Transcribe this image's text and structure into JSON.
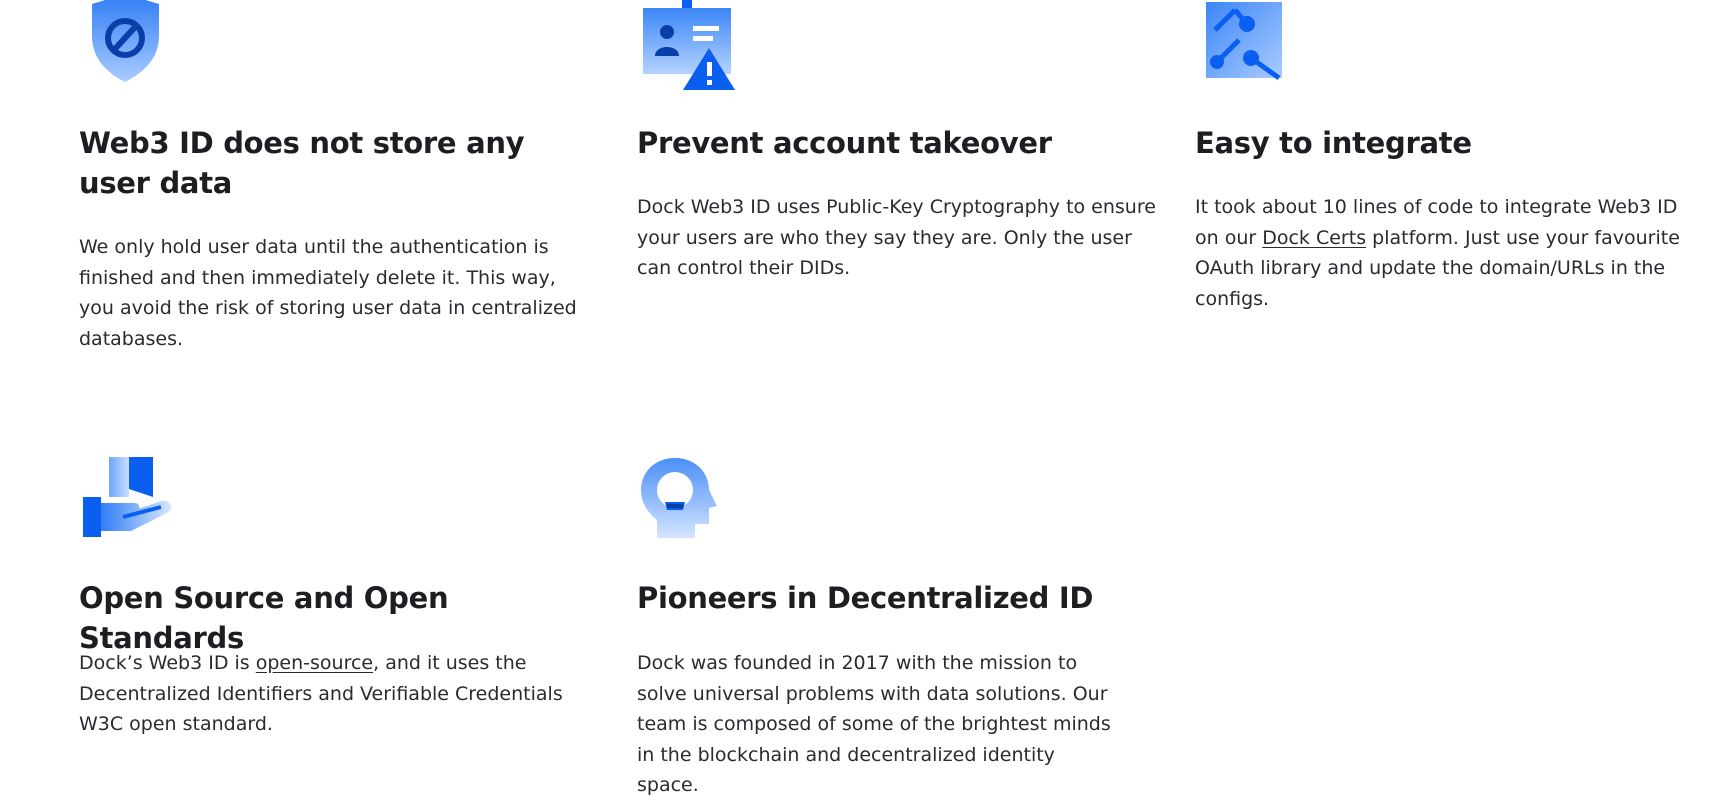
{
  "colors": {
    "accent": "#0b5ff0",
    "accent_light": "#9dc3ff",
    "heading": "#1d1d22",
    "body": "#2a2a30"
  },
  "features": [
    {
      "icon": "shield-block-icon",
      "title": "Web3 ID does not store any user data",
      "body": "We only hold user data until the authentication is finished and then immediately delete it. This way, you avoid the risk of storing user data in centralized databases."
    },
    {
      "icon": "id-card-warning-icon",
      "title": "Prevent account takeover",
      "body": "Dock Web3 ID uses Public-Key Cryptography to ensure your users are who they say they are. Only the user can control their DIDs."
    },
    {
      "icon": "integration-nodes-icon",
      "title": "Easy to integrate",
      "body_before": "It took about 10 lines of code to integrate Web3 ID on our ",
      "link": "Dock Certs",
      "body_after": " platform. Just use your favourite OAuth library and update the domain/URLs in the configs."
    },
    {
      "icon": "hand-book-icon",
      "title": "Open Source and Open Standards",
      "body_before": "Dock’s Web3 ID is ",
      "link": "open-source",
      "body_after": ", and it uses the Decentralized Identifiers and Verifiable Credentials W3C open standard."
    },
    {
      "icon": "head-lightbulb-icon",
      "title": "Pioneers in Decentralized ID",
      "body": "Dock was founded in 2017 with the mission to solve universal problems with data solutions. Our team is composed of some of the brightest minds in the blockchain and decentralized identity space."
    }
  ]
}
